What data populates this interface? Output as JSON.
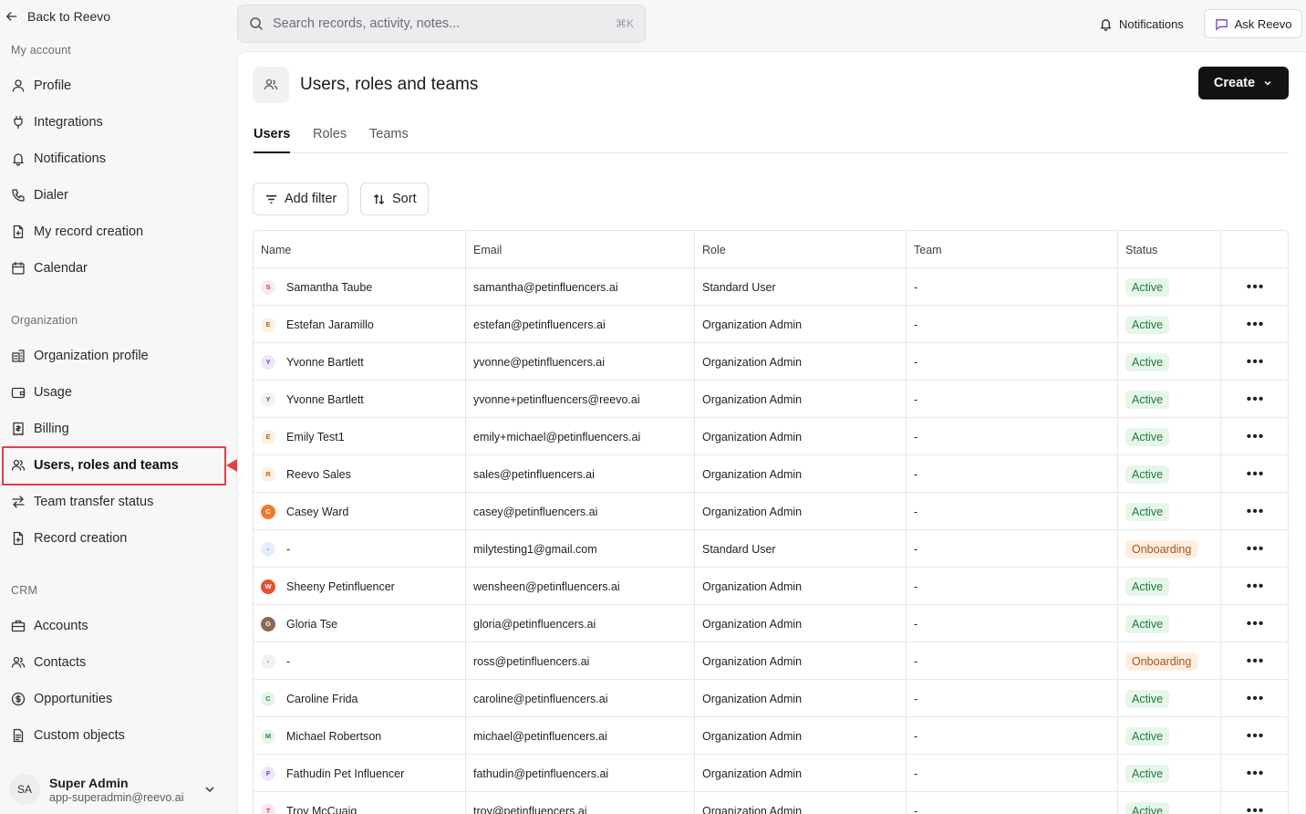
{
  "sidebar": {
    "back_label": "Back to Reevo",
    "my_account_label": "My account",
    "my_account_items": [
      {
        "label": "Profile",
        "icon": "user-icon"
      },
      {
        "label": "Integrations",
        "icon": "plug-icon"
      },
      {
        "label": "Notifications",
        "icon": "bell-icon"
      },
      {
        "label": "Dialer",
        "icon": "phone-icon"
      },
      {
        "label": "My record creation",
        "icon": "file-plus-icon"
      },
      {
        "label": "Calendar",
        "icon": "calendar-icon"
      }
    ],
    "organization_label": "Organization",
    "organization_items": [
      {
        "label": "Organization profile",
        "icon": "building-icon"
      },
      {
        "label": "Usage",
        "icon": "wallet-icon"
      },
      {
        "label": "Billing",
        "icon": "receipt-icon"
      },
      {
        "label": "Users, roles and teams",
        "icon": "users-icon"
      },
      {
        "label": "Team transfer status",
        "icon": "transfer-icon"
      },
      {
        "label": "Record creation",
        "icon": "file-plus-icon"
      }
    ],
    "crm_label": "CRM",
    "crm_items": [
      {
        "label": "Accounts",
        "icon": "briefcase-icon"
      },
      {
        "label": "Contacts",
        "icon": "users-icon"
      },
      {
        "label": "Opportunities",
        "icon": "dollar-circle-icon"
      },
      {
        "label": "Custom objects",
        "icon": "document-icon"
      }
    ],
    "user": {
      "initials": "SA",
      "name": "Super Admin",
      "email": "app-superadmin@reevo.ai"
    }
  },
  "topbar": {
    "search_placeholder": "Search records, activity, notes...",
    "search_shortcut": "⌘K",
    "notifications_label": "Notifications",
    "ask_label": "Ask Reevo"
  },
  "page": {
    "title": "Users, roles and teams",
    "create_label": "Create",
    "tabs": [
      "Users",
      "Roles",
      "Teams"
    ],
    "add_filter_label": "Add filter",
    "sort_label": "Sort"
  },
  "table": {
    "columns": [
      "Name",
      "Email",
      "Role",
      "Team",
      "Status",
      ""
    ],
    "rows": [
      {
        "initial": "S",
        "name": "Samantha Taube",
        "email": "samantha@petinfluencers.ai",
        "role": "Standard User",
        "team": "-",
        "status": "Active",
        "avatar_bg": "#fde8ef",
        "avatar_fg": "#c2416b"
      },
      {
        "initial": "E",
        "name": "Estefan Jaramillo",
        "email": "estefan@petinfluencers.ai",
        "role": "Organization Admin",
        "team": "-",
        "status": "Active",
        "avatar_bg": "#fdf0e2",
        "avatar_fg": "#b5641d"
      },
      {
        "initial": "Y",
        "name": "Yvonne Bartlett",
        "email": "yvonne@petinfluencers.ai",
        "role": "Organization Admin",
        "team": "-",
        "status": "Active",
        "avatar_bg": "#efe8fc",
        "avatar_fg": "#6a3fc4"
      },
      {
        "initial": "Y",
        "name": "Yvonne Bartlett",
        "email": "yvonne+petinfluencers@reevo.ai",
        "role": "Organization Admin",
        "team": "-",
        "status": "Active",
        "avatar_bg": "#f1f1f3",
        "avatar_fg": "#555"
      },
      {
        "initial": "E",
        "name": "Emily Test1",
        "email": "emily+michael@petinfluencers.ai",
        "role": "Organization Admin",
        "team": "-",
        "status": "Active",
        "avatar_bg": "#fdf0e2",
        "avatar_fg": "#b5641d"
      },
      {
        "initial": "R",
        "name": "Reevo Sales",
        "email": "sales@petinfluencers.ai",
        "role": "Organization Admin",
        "team": "-",
        "status": "Active",
        "avatar_bg": "#fdf0e2",
        "avatar_fg": "#b5641d"
      },
      {
        "initial": "C",
        "name": "Casey Ward",
        "email": "casey@petinfluencers.ai",
        "role": "Organization Admin",
        "team": "-",
        "status": "Active",
        "avatar_bg": "#ee7a28",
        "avatar_fg": "#ffffff"
      },
      {
        "initial": "-",
        "name": "-",
        "email": "milytesting1@gmail.com",
        "role": "Standard User",
        "team": "-",
        "status": "Onboarding",
        "avatar_bg": "#e6eefc",
        "avatar_fg": "#4a6fb3"
      },
      {
        "initial": "W",
        "name": "Sheeny Petinfluencer",
        "email": "wensheen@petinfluencers.ai",
        "role": "Organization Admin",
        "team": "-",
        "status": "Active",
        "avatar_bg": "#e8502f",
        "avatar_fg": "#ffffff"
      },
      {
        "initial": "G",
        "name": "Gloria Tse",
        "email": "gloria@petinfluencers.ai",
        "role": "Organization Admin",
        "team": "-",
        "status": "Active",
        "avatar_bg": "#8a6a55",
        "avatar_fg": "#ffffff"
      },
      {
        "initial": "-",
        "name": "-",
        "email": "ross@petinfluencers.ai",
        "role": "Organization Admin",
        "team": "-",
        "status": "Onboarding",
        "avatar_bg": "#f1f1f3",
        "avatar_fg": "#777"
      },
      {
        "initial": "C",
        "name": "Caroline Frida",
        "email": "caroline@petinfluencers.ai",
        "role": "Organization Admin",
        "team": "-",
        "status": "Active",
        "avatar_bg": "#e4f6ea",
        "avatar_fg": "#2c8a4b"
      },
      {
        "initial": "M",
        "name": "Michael Robertson",
        "email": "michael@petinfluencers.ai",
        "role": "Organization Admin",
        "team": "-",
        "status": "Active",
        "avatar_bg": "#e4f6ea",
        "avatar_fg": "#2c8a4b"
      },
      {
        "initial": "F",
        "name": "Fathudin Pet Influencer",
        "email": "fathudin@petinfluencers.ai",
        "role": "Organization Admin",
        "team": "-",
        "status": "Active",
        "avatar_bg": "#efe8fc",
        "avatar_fg": "#6a3fc4"
      },
      {
        "initial": "T",
        "name": "Troy McCuaig",
        "email": "troy@petinfluencers.ai",
        "role": "Organization Admin",
        "team": "-",
        "status": "Active",
        "avatar_bg": "#fde8ef",
        "avatar_fg": "#c2416b"
      }
    ]
  },
  "colors": {
    "highlight": "#e0414b",
    "active_badge_bg": "#e6f6ea",
    "onboarding_badge_bg": "#fdefe0"
  }
}
